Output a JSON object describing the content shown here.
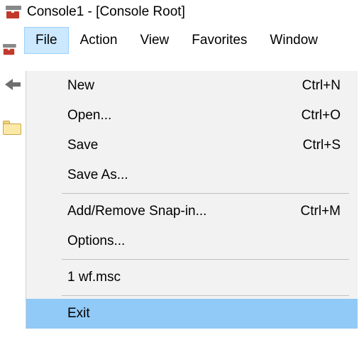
{
  "window": {
    "title": "Console1 - [Console Root]"
  },
  "menubar": {
    "file": "File",
    "action": "Action",
    "view": "View",
    "favorites": "Favorites",
    "window": "Window"
  },
  "file_menu": {
    "new": {
      "label": "New",
      "shortcut": "Ctrl+N"
    },
    "open": {
      "label": "Open...",
      "shortcut": "Ctrl+O"
    },
    "save": {
      "label": "Save",
      "shortcut": "Ctrl+S"
    },
    "save_as": {
      "label": "Save As...",
      "shortcut": ""
    },
    "add_remove": {
      "label": "Add/Remove Snap-in...",
      "shortcut": "Ctrl+M"
    },
    "options": {
      "label": "Options...",
      "shortcut": ""
    },
    "recent1": {
      "label": "1 wf.msc",
      "shortcut": ""
    },
    "exit": {
      "label": "Exit",
      "shortcut": ""
    }
  }
}
